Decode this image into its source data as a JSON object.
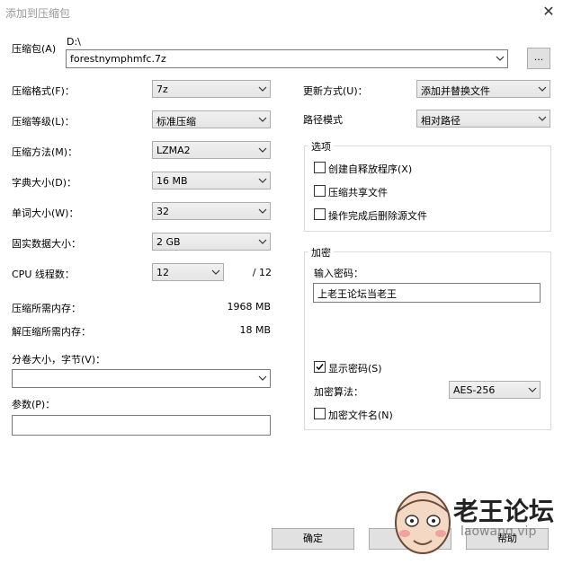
{
  "window": {
    "title": "添加到压缩包"
  },
  "archive": {
    "label": "压缩包(A)",
    "path": "D:\\",
    "filename": "forestnymphmfc.7z",
    "browse_label": "..."
  },
  "left": {
    "format": {
      "label": "压缩格式(F)：",
      "value": "7z"
    },
    "level": {
      "label": "压缩等级(L)：",
      "value": "标准压缩"
    },
    "method": {
      "label": "压缩方法(M)：",
      "value": "LZMA2"
    },
    "dict": {
      "label": "字典大小(D)：",
      "value": "16 MB"
    },
    "word": {
      "label": "单词大小(W)：",
      "value": "32"
    },
    "solid": {
      "label": "固实数据大小：",
      "value": "2 GB"
    },
    "threads": {
      "label": "CPU 线程数：",
      "value": "12",
      "total": "/ 12"
    },
    "mem_comp": {
      "label": "压缩所需内存：",
      "value": "1968 MB"
    },
    "mem_decomp": {
      "label": "解压缩所需内存：",
      "value": "18 MB"
    },
    "split": {
      "label": "分卷大小，字节(V)：",
      "value": ""
    },
    "params": {
      "label": "参数(P)：",
      "value": ""
    }
  },
  "right": {
    "update": {
      "label": "更新方式(U)：",
      "value": "添加并替换文件"
    },
    "path_mode": {
      "label": "路径模式",
      "value": "相对路径"
    },
    "options": {
      "title": "选项",
      "items": [
        {
          "label": "创建自释放程序(X)",
          "checked": false
        },
        {
          "label": "压缩共享文件",
          "checked": false
        },
        {
          "label": "操作完成后删除源文件",
          "checked": false
        }
      ]
    },
    "encryption": {
      "title": "加密",
      "password_label": "输入密码：",
      "password_value": "上老王论坛当老王",
      "show_password": {
        "label": "显示密码(S)",
        "checked": true
      },
      "method_label": "加密算法：",
      "method_value": "AES-256",
      "encrypt_names": {
        "label": "加密文件名(N)",
        "checked": false
      }
    }
  },
  "buttons": {
    "ok": "确定",
    "cancel": "取消",
    "help": "帮助"
  },
  "watermark": {
    "name": "老王论坛",
    "domain": "laowang.vip"
  }
}
